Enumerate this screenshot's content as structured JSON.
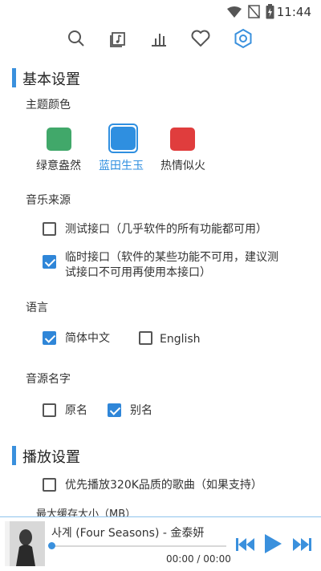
{
  "status_bar": {
    "time": "11:44",
    "icons": [
      "wifi-icon",
      "no-signal-icon",
      "battery-icon"
    ]
  },
  "nav": {
    "items": [
      {
        "name": "search-icon"
      },
      {
        "name": "music-library-icon"
      },
      {
        "name": "charts-icon"
      },
      {
        "name": "favorites-icon"
      },
      {
        "name": "settings-icon",
        "active": true
      }
    ],
    "active_color": "#3a90dd",
    "icon_color": "#555555"
  },
  "basic_settings": {
    "title": "基本设置",
    "theme": {
      "label": "主题颜色",
      "options": [
        {
          "label": "绿意盎然",
          "color": "#41a86a",
          "selected": false
        },
        {
          "label": "蓝田生玉",
          "color": "#2f8fe0",
          "selected": true
        },
        {
          "label": "热情似火",
          "color": "#e03d3d",
          "selected": false
        }
      ]
    },
    "music_source": {
      "label": "音乐来源",
      "options": [
        {
          "lines": [
            "测试接口（几乎软件的所有功能都可用）"
          ],
          "checked": false
        },
        {
          "lines": [
            "临时接口（软件的某些功能不可用，建议测",
            "试接口不可用再使用本接口）"
          ],
          "checked": true
        }
      ]
    },
    "language": {
      "label": "语言",
      "options": [
        {
          "label": "简体中文",
          "checked": true
        },
        {
          "label": "English",
          "checked": false
        }
      ]
    },
    "source_name": {
      "label": "音源名字",
      "options": [
        {
          "label": "原名",
          "checked": false
        },
        {
          "label": "别名",
          "checked": true
        }
      ]
    }
  },
  "playback_settings": {
    "title": "播放设置",
    "prefer_320k": {
      "label": "优先播放320K品质的歌曲（如果支持）",
      "checked": false
    },
    "max_cache_label": "最大缓存大小（MB）"
  },
  "player": {
    "song_title": "사계 (Four Seasons) - 金泰妍",
    "time": "00:00 / 00:00",
    "progress": 0,
    "accent": "#3a90dd"
  }
}
